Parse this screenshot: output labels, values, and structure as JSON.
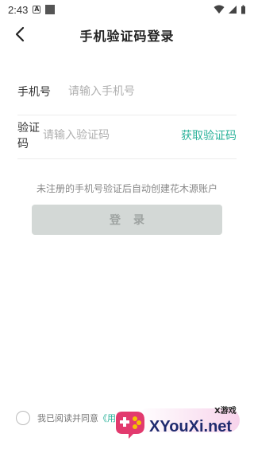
{
  "status_bar": {
    "time": "2:43",
    "a_badge": "A"
  },
  "header": {
    "title": "手机验证码登录"
  },
  "phone_row": {
    "label": "手机号",
    "placeholder": "请输入手机号",
    "value": ""
  },
  "code_row": {
    "label": "验证码",
    "placeholder": "请输入验证码",
    "value": "",
    "get_code_label": "获取验证码"
  },
  "notice": "未注册的手机号验证后自动创建花木源账户",
  "login_button": {
    "label": "登录"
  },
  "agreement": {
    "text": "我已阅读并同意",
    "link_text": "《用户"
  },
  "watermark": {
    "small_text": "X游戏",
    "brand_text": "XYouXi.net"
  },
  "colors": {
    "accent": "#2bb29a",
    "button_disabled": "#d3d8d6",
    "divider": "#ececec"
  }
}
